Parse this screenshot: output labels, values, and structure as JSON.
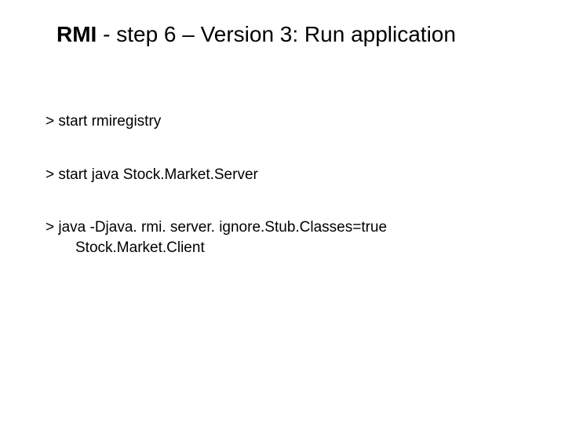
{
  "title": {
    "bold": "RMI",
    "rest": " - step 6 – Version 3: Run application"
  },
  "commands": {
    "cmd1_prefix": "> ",
    "cmd1_text": "start rmiregistry",
    "cmd2_prefix": "> ",
    "cmd2_text": "start java Stock.Market.Server",
    "cmd3_prefix": "> ",
    "cmd3_text": "java -Djava. rmi. server. ignore.Stub.Classes=true",
    "cmd3_line2": "Stock.Market.Client"
  }
}
